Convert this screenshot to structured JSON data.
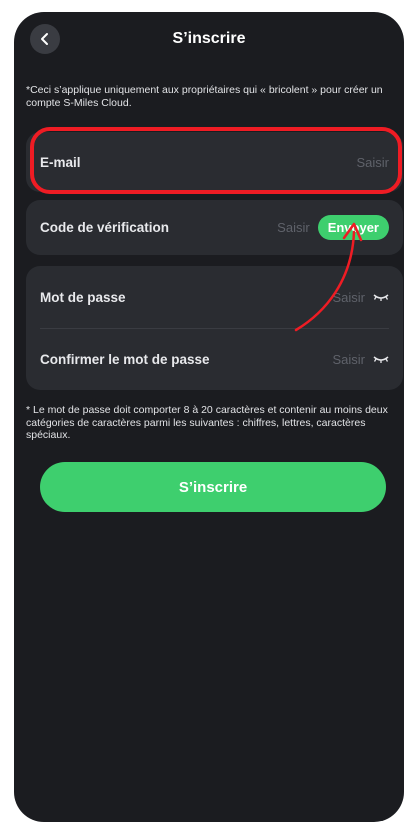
{
  "header": {
    "title": "S’inscrire"
  },
  "notice": "*Ceci s’applique uniquement aux propriétaires qui « bricolent » pour créer un compte S-Miles Cloud.",
  "form": {
    "email": {
      "label": "E-mail",
      "placeholder": "Saisir"
    },
    "code": {
      "label": "Code de vérification",
      "placeholder": "Saisir",
      "send_label": "Envoyer"
    },
    "password": {
      "label": "Mot de passe",
      "placeholder": "Saisir"
    },
    "confirm": {
      "label": "Confirmer le mot de passe",
      "placeholder": "Saisir"
    }
  },
  "password_note": "* Le mot de passe doit comporter 8 à 20 caractères et contenir au moins deux catégories de caractères parmi les suivantes : chiffres, lettres, caractères spéciaux.",
  "submit_label": "S’inscrire",
  "colors": {
    "background": "#1b1c20",
    "card": "#2a2c31",
    "accent_green": "#3ecf6e",
    "annotation_red": "#ef1c24"
  },
  "icons": {
    "back": "chevron-left-icon",
    "eye": "eye-closed-icon"
  }
}
